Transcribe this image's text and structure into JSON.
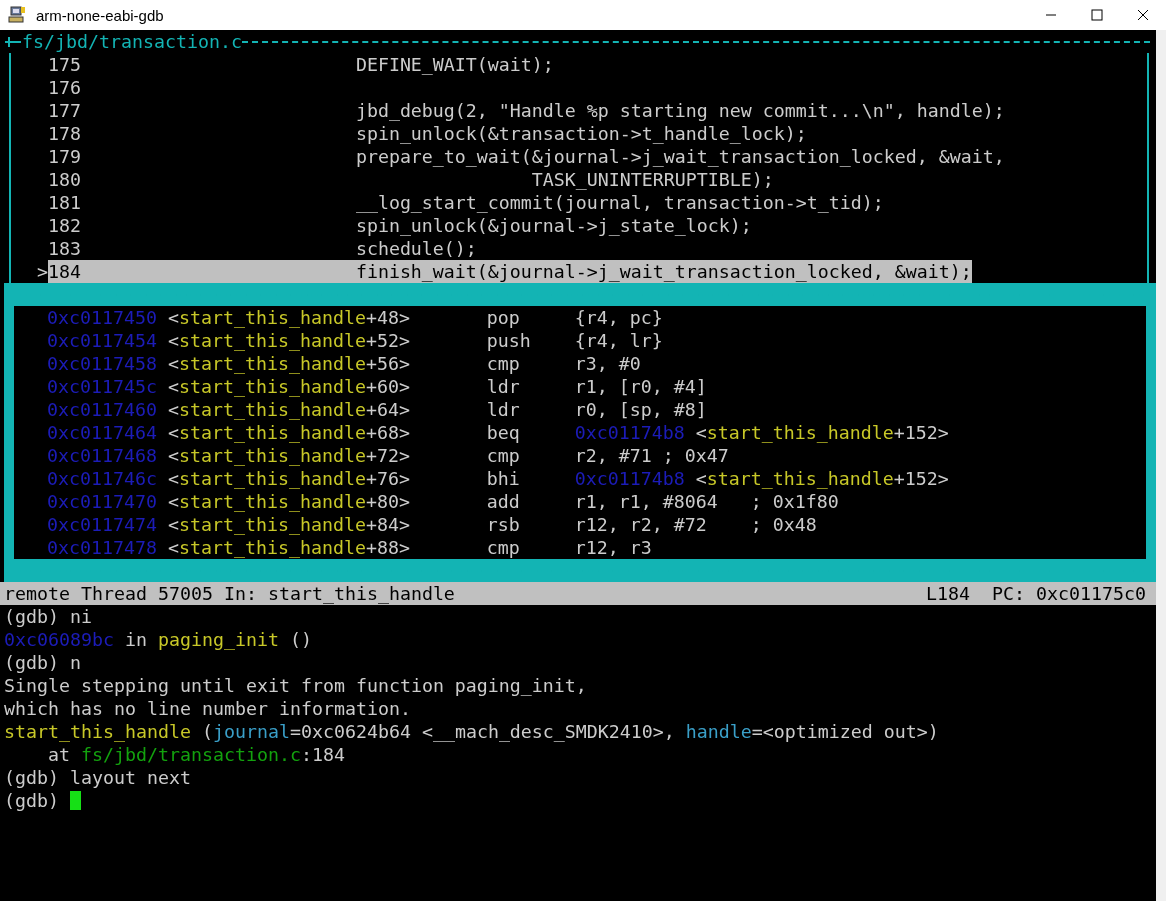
{
  "window": {
    "title": "arm-none-eabi-gdb"
  },
  "source": {
    "title": "fs/jbd/transaction.c",
    "current_marker": ">",
    "lines": [
      {
        "number": "175",
        "code": "DEFINE_WAIT(wait);",
        "current": false
      },
      {
        "number": "176",
        "current": false
      },
      {
        "number": "177",
        "code": "jbd_debug(2, \"Handle %p starting new commit...\\n\", handle);",
        "current": false
      },
      {
        "number": "178",
        "code": "spin_unlock(&transaction->t_handle_lock);",
        "current": false
      },
      {
        "number": "179",
        "code": "prepare_to_wait(&journal->j_wait_transaction_locked, &wait,",
        "current": false
      },
      {
        "number": "180",
        "code": "                TASK_UNINTERRUPTIBLE);",
        "current": false
      },
      {
        "number": "181",
        "code": "__log_start_commit(journal, transaction->t_tid);",
        "current": false
      },
      {
        "number": "182",
        "code": "spin_unlock(&journal->j_state_lock);",
        "current": false
      },
      {
        "number": "183",
        "code": "schedule();",
        "current": false
      },
      {
        "number": "184",
        "code": "finish_wait(&journal->j_wait_transaction_locked, &wait);",
        "current": true
      }
    ]
  },
  "disassembly": {
    "rows": [
      {
        "address": "0xc0117450",
        "symbol": [
          {
            "kind": "plain",
            "text": "<"
          },
          {
            "kind": "function",
            "text": "start_this_handle"
          },
          {
            "kind": "plain",
            "text": "+48>"
          }
        ],
        "mnemonic": "pop",
        "operands": [
          {
            "kind": "plain",
            "text": "{r4, pc}"
          }
        ]
      },
      {
        "address": "0xc0117454",
        "symbol": [
          {
            "kind": "plain",
            "text": "<"
          },
          {
            "kind": "function",
            "text": "start_this_handle"
          },
          {
            "kind": "plain",
            "text": "+52>"
          }
        ],
        "mnemonic": "push",
        "operands": [
          {
            "kind": "plain",
            "text": "{r4, lr}"
          }
        ]
      },
      {
        "address": "0xc0117458",
        "symbol": [
          {
            "kind": "plain",
            "text": "<"
          },
          {
            "kind": "function",
            "text": "start_this_handle"
          },
          {
            "kind": "plain",
            "text": "+56>"
          }
        ],
        "mnemonic": "cmp",
        "operands": [
          {
            "kind": "plain",
            "text": "r3, #0"
          }
        ]
      },
      {
        "address": "0xc011745c",
        "symbol": [
          {
            "kind": "plain",
            "text": "<"
          },
          {
            "kind": "function",
            "text": "start_this_handle"
          },
          {
            "kind": "plain",
            "text": "+60>"
          }
        ],
        "mnemonic": "ldr",
        "operands": [
          {
            "kind": "plain",
            "text": "r1, [r0, #4]"
          }
        ]
      },
      {
        "address": "0xc0117460",
        "symbol": [
          {
            "kind": "plain",
            "text": "<"
          },
          {
            "kind": "function",
            "text": "start_this_handle"
          },
          {
            "kind": "plain",
            "text": "+64>"
          }
        ],
        "mnemonic": "ldr",
        "operands": [
          {
            "kind": "plain",
            "text": "r0, [sp, #8]"
          }
        ]
      },
      {
        "address": "0xc0117464",
        "symbol": [
          {
            "kind": "plain",
            "text": "<"
          },
          {
            "kind": "function",
            "text": "start_this_handle"
          },
          {
            "kind": "plain",
            "text": "+68>"
          }
        ],
        "mnemonic": "beq",
        "operands": [
          {
            "kind": "address",
            "text": "0xc01174b8"
          },
          {
            "kind": "plain",
            "text": " <"
          },
          {
            "kind": "function",
            "text": "start_this_handle"
          },
          {
            "kind": "plain",
            "text": "+152>"
          }
        ]
      },
      {
        "address": "0xc0117468",
        "symbol": [
          {
            "kind": "plain",
            "text": "<"
          },
          {
            "kind": "function",
            "text": "start_this_handle"
          },
          {
            "kind": "plain",
            "text": "+72>"
          }
        ],
        "mnemonic": "cmp",
        "operands": [
          {
            "kind": "plain",
            "text": "r2, #71 ; 0x47"
          }
        ]
      },
      {
        "address": "0xc011746c",
        "symbol": [
          {
            "kind": "plain",
            "text": "<"
          },
          {
            "kind": "function",
            "text": "start_this_handle"
          },
          {
            "kind": "plain",
            "text": "+76>"
          }
        ],
        "mnemonic": "bhi",
        "operands": [
          {
            "kind": "address",
            "text": "0xc01174b8"
          },
          {
            "kind": "plain",
            "text": " <"
          },
          {
            "kind": "function",
            "text": "start_this_handle"
          },
          {
            "kind": "plain",
            "text": "+152>"
          }
        ]
      },
      {
        "address": "0xc0117470",
        "symbol": [
          {
            "kind": "plain",
            "text": "<"
          },
          {
            "kind": "function",
            "text": "start_this_handle"
          },
          {
            "kind": "plain",
            "text": "+80>"
          }
        ],
        "mnemonic": "add",
        "operands": [
          {
            "kind": "plain",
            "text": "r1, r1, #8064   ; 0x1f80"
          }
        ]
      },
      {
        "address": "0xc0117474",
        "symbol": [
          {
            "kind": "plain",
            "text": "<"
          },
          {
            "kind": "function",
            "text": "start_this_handle"
          },
          {
            "kind": "plain",
            "text": "+84>"
          }
        ],
        "mnemonic": "rsb",
        "operands": [
          {
            "kind": "plain",
            "text": "r12, r2, #72    ; 0x48"
          }
        ]
      },
      {
        "address": "0xc0117478",
        "symbol": [
          {
            "kind": "plain",
            "text": "<"
          },
          {
            "kind": "function",
            "text": "start_this_handle"
          },
          {
            "kind": "plain",
            "text": "+88>"
          }
        ],
        "mnemonic": "cmp",
        "operands": [
          {
            "kind": "plain",
            "text": "r12, r3"
          }
        ]
      }
    ]
  },
  "status_bar": {
    "left": "remote Thread 57005 In: start_this_handle",
    "line": "L184",
    "pc": "PC: 0xc01175c0"
  },
  "console": {
    "lines": [
      {
        "segments": [
          {
            "kind": "plain",
            "text": "(gdb) ni"
          }
        ]
      },
      {
        "segments": [
          {
            "kind": "address",
            "text": "0xc06089bc"
          },
          {
            "kind": "plain",
            "text": " in "
          },
          {
            "kind": "function",
            "text": "paging_init"
          },
          {
            "kind": "plain",
            "text": " ()"
          }
        ]
      },
      {
        "segments": [
          {
            "kind": "plain",
            "text": "(gdb) n"
          }
        ]
      },
      {
        "segments": [
          {
            "kind": "plain",
            "text": "Single stepping until exit from function paging_init,"
          }
        ]
      },
      {
        "segments": [
          {
            "kind": "plain",
            "text": "which has no line number information."
          }
        ]
      },
      {
        "segments": [
          {
            "kind": "function",
            "text": "start_this_handle"
          },
          {
            "kind": "plain",
            "text": " ("
          },
          {
            "kind": "param",
            "text": "journal"
          },
          {
            "kind": "plain",
            "text": "=0xc0624b64 <__mach_desc_SMDK2410>, "
          },
          {
            "kind": "param",
            "text": "handle"
          },
          {
            "kind": "plain",
            "text": "=<optimized out>)"
          }
        ]
      },
      {
        "segments": [
          {
            "kind": "plain",
            "text": "    at "
          },
          {
            "kind": "file",
            "text": "fs/jbd/transaction.c"
          },
          {
            "kind": "plain",
            "text": ":184"
          }
        ]
      },
      {
        "segments": [
          {
            "kind": "plain",
            "text": "(gdb) layout next"
          }
        ]
      },
      {
        "segments": [
          {
            "kind": "plain",
            "text": "(gdb) "
          }
        ],
        "cursor": true
      }
    ]
  }
}
